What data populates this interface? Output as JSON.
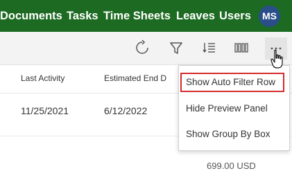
{
  "nav": {
    "items": [
      "Documents",
      "Tasks",
      "Time Sheets",
      "Leaves",
      "Users"
    ],
    "avatar_initials": "MS"
  },
  "toolbar": {
    "refresh_icon": "refresh-icon",
    "filter_icon": "filter-icon",
    "list_icon": "list-settings-icon",
    "columns_icon": "columns-icon",
    "more_icon": "more-icon"
  },
  "grid": {
    "headers": [
      "Last Activity",
      "Estimated End D"
    ],
    "row": [
      "11/25/2021",
      "6/12/2022"
    ],
    "partial_value": "699.00 USD"
  },
  "menu": {
    "items": [
      "Show Auto Filter Row",
      "Hide Preview Panel",
      "Show Group By Box"
    ]
  },
  "colors": {
    "nav_bg": "#1d6b22",
    "avatar_bg": "#2a4e8a",
    "highlight": "#d42a2a"
  }
}
